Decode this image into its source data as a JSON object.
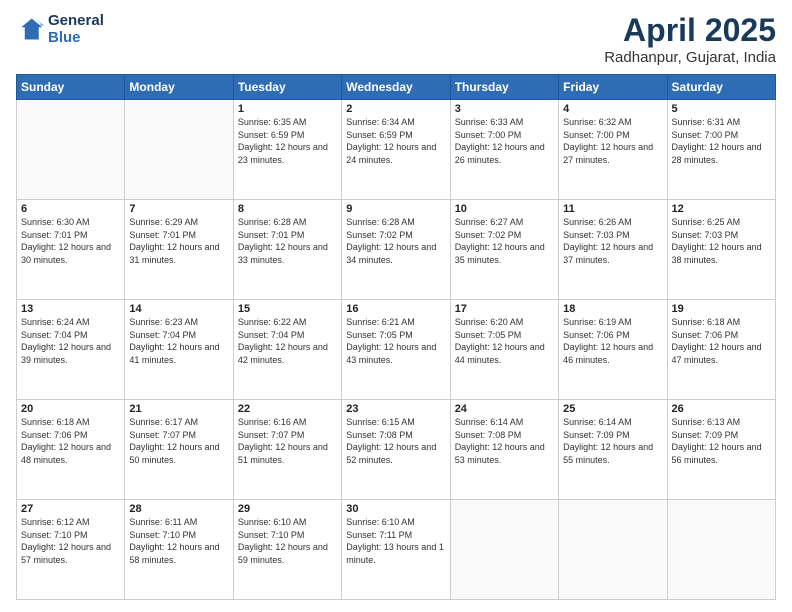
{
  "header": {
    "logo_line1": "General",
    "logo_line2": "Blue",
    "title": "April 2025",
    "subtitle": "Radhanpur, Gujarat, India"
  },
  "weekdays": [
    "Sunday",
    "Monday",
    "Tuesday",
    "Wednesday",
    "Thursday",
    "Friday",
    "Saturday"
  ],
  "weeks": [
    [
      {
        "day": "",
        "sunrise": "",
        "sunset": "",
        "daylight": ""
      },
      {
        "day": "",
        "sunrise": "",
        "sunset": "",
        "daylight": ""
      },
      {
        "day": "1",
        "sunrise": "Sunrise: 6:35 AM",
        "sunset": "Sunset: 6:59 PM",
        "daylight": "Daylight: 12 hours and 23 minutes."
      },
      {
        "day": "2",
        "sunrise": "Sunrise: 6:34 AM",
        "sunset": "Sunset: 6:59 PM",
        "daylight": "Daylight: 12 hours and 24 minutes."
      },
      {
        "day": "3",
        "sunrise": "Sunrise: 6:33 AM",
        "sunset": "Sunset: 7:00 PM",
        "daylight": "Daylight: 12 hours and 26 minutes."
      },
      {
        "day": "4",
        "sunrise": "Sunrise: 6:32 AM",
        "sunset": "Sunset: 7:00 PM",
        "daylight": "Daylight: 12 hours and 27 minutes."
      },
      {
        "day": "5",
        "sunrise": "Sunrise: 6:31 AM",
        "sunset": "Sunset: 7:00 PM",
        "daylight": "Daylight: 12 hours and 28 minutes."
      }
    ],
    [
      {
        "day": "6",
        "sunrise": "Sunrise: 6:30 AM",
        "sunset": "Sunset: 7:01 PM",
        "daylight": "Daylight: 12 hours and 30 minutes."
      },
      {
        "day": "7",
        "sunrise": "Sunrise: 6:29 AM",
        "sunset": "Sunset: 7:01 PM",
        "daylight": "Daylight: 12 hours and 31 minutes."
      },
      {
        "day": "8",
        "sunrise": "Sunrise: 6:28 AM",
        "sunset": "Sunset: 7:01 PM",
        "daylight": "Daylight: 12 hours and 33 minutes."
      },
      {
        "day": "9",
        "sunrise": "Sunrise: 6:28 AM",
        "sunset": "Sunset: 7:02 PM",
        "daylight": "Daylight: 12 hours and 34 minutes."
      },
      {
        "day": "10",
        "sunrise": "Sunrise: 6:27 AM",
        "sunset": "Sunset: 7:02 PM",
        "daylight": "Daylight: 12 hours and 35 minutes."
      },
      {
        "day": "11",
        "sunrise": "Sunrise: 6:26 AM",
        "sunset": "Sunset: 7:03 PM",
        "daylight": "Daylight: 12 hours and 37 minutes."
      },
      {
        "day": "12",
        "sunrise": "Sunrise: 6:25 AM",
        "sunset": "Sunset: 7:03 PM",
        "daylight": "Daylight: 12 hours and 38 minutes."
      }
    ],
    [
      {
        "day": "13",
        "sunrise": "Sunrise: 6:24 AM",
        "sunset": "Sunset: 7:04 PM",
        "daylight": "Daylight: 12 hours and 39 minutes."
      },
      {
        "day": "14",
        "sunrise": "Sunrise: 6:23 AM",
        "sunset": "Sunset: 7:04 PM",
        "daylight": "Daylight: 12 hours and 41 minutes."
      },
      {
        "day": "15",
        "sunrise": "Sunrise: 6:22 AM",
        "sunset": "Sunset: 7:04 PM",
        "daylight": "Daylight: 12 hours and 42 minutes."
      },
      {
        "day": "16",
        "sunrise": "Sunrise: 6:21 AM",
        "sunset": "Sunset: 7:05 PM",
        "daylight": "Daylight: 12 hours and 43 minutes."
      },
      {
        "day": "17",
        "sunrise": "Sunrise: 6:20 AM",
        "sunset": "Sunset: 7:05 PM",
        "daylight": "Daylight: 12 hours and 44 minutes."
      },
      {
        "day": "18",
        "sunrise": "Sunrise: 6:19 AM",
        "sunset": "Sunset: 7:06 PM",
        "daylight": "Daylight: 12 hours and 46 minutes."
      },
      {
        "day": "19",
        "sunrise": "Sunrise: 6:18 AM",
        "sunset": "Sunset: 7:06 PM",
        "daylight": "Daylight: 12 hours and 47 minutes."
      }
    ],
    [
      {
        "day": "20",
        "sunrise": "Sunrise: 6:18 AM",
        "sunset": "Sunset: 7:06 PM",
        "daylight": "Daylight: 12 hours and 48 minutes."
      },
      {
        "day": "21",
        "sunrise": "Sunrise: 6:17 AM",
        "sunset": "Sunset: 7:07 PM",
        "daylight": "Daylight: 12 hours and 50 minutes."
      },
      {
        "day": "22",
        "sunrise": "Sunrise: 6:16 AM",
        "sunset": "Sunset: 7:07 PM",
        "daylight": "Daylight: 12 hours and 51 minutes."
      },
      {
        "day": "23",
        "sunrise": "Sunrise: 6:15 AM",
        "sunset": "Sunset: 7:08 PM",
        "daylight": "Daylight: 12 hours and 52 minutes."
      },
      {
        "day": "24",
        "sunrise": "Sunrise: 6:14 AM",
        "sunset": "Sunset: 7:08 PM",
        "daylight": "Daylight: 12 hours and 53 minutes."
      },
      {
        "day": "25",
        "sunrise": "Sunrise: 6:14 AM",
        "sunset": "Sunset: 7:09 PM",
        "daylight": "Daylight: 12 hours and 55 minutes."
      },
      {
        "day": "26",
        "sunrise": "Sunrise: 6:13 AM",
        "sunset": "Sunset: 7:09 PM",
        "daylight": "Daylight: 12 hours and 56 minutes."
      }
    ],
    [
      {
        "day": "27",
        "sunrise": "Sunrise: 6:12 AM",
        "sunset": "Sunset: 7:10 PM",
        "daylight": "Daylight: 12 hours and 57 minutes."
      },
      {
        "day": "28",
        "sunrise": "Sunrise: 6:11 AM",
        "sunset": "Sunset: 7:10 PM",
        "daylight": "Daylight: 12 hours and 58 minutes."
      },
      {
        "day": "29",
        "sunrise": "Sunrise: 6:10 AM",
        "sunset": "Sunset: 7:10 PM",
        "daylight": "Daylight: 12 hours and 59 minutes."
      },
      {
        "day": "30",
        "sunrise": "Sunrise: 6:10 AM",
        "sunset": "Sunset: 7:11 PM",
        "daylight": "Daylight: 13 hours and 1 minute."
      },
      {
        "day": "",
        "sunrise": "",
        "sunset": "",
        "daylight": ""
      },
      {
        "day": "",
        "sunrise": "",
        "sunset": "",
        "daylight": ""
      },
      {
        "day": "",
        "sunrise": "",
        "sunset": "",
        "daylight": ""
      }
    ]
  ]
}
